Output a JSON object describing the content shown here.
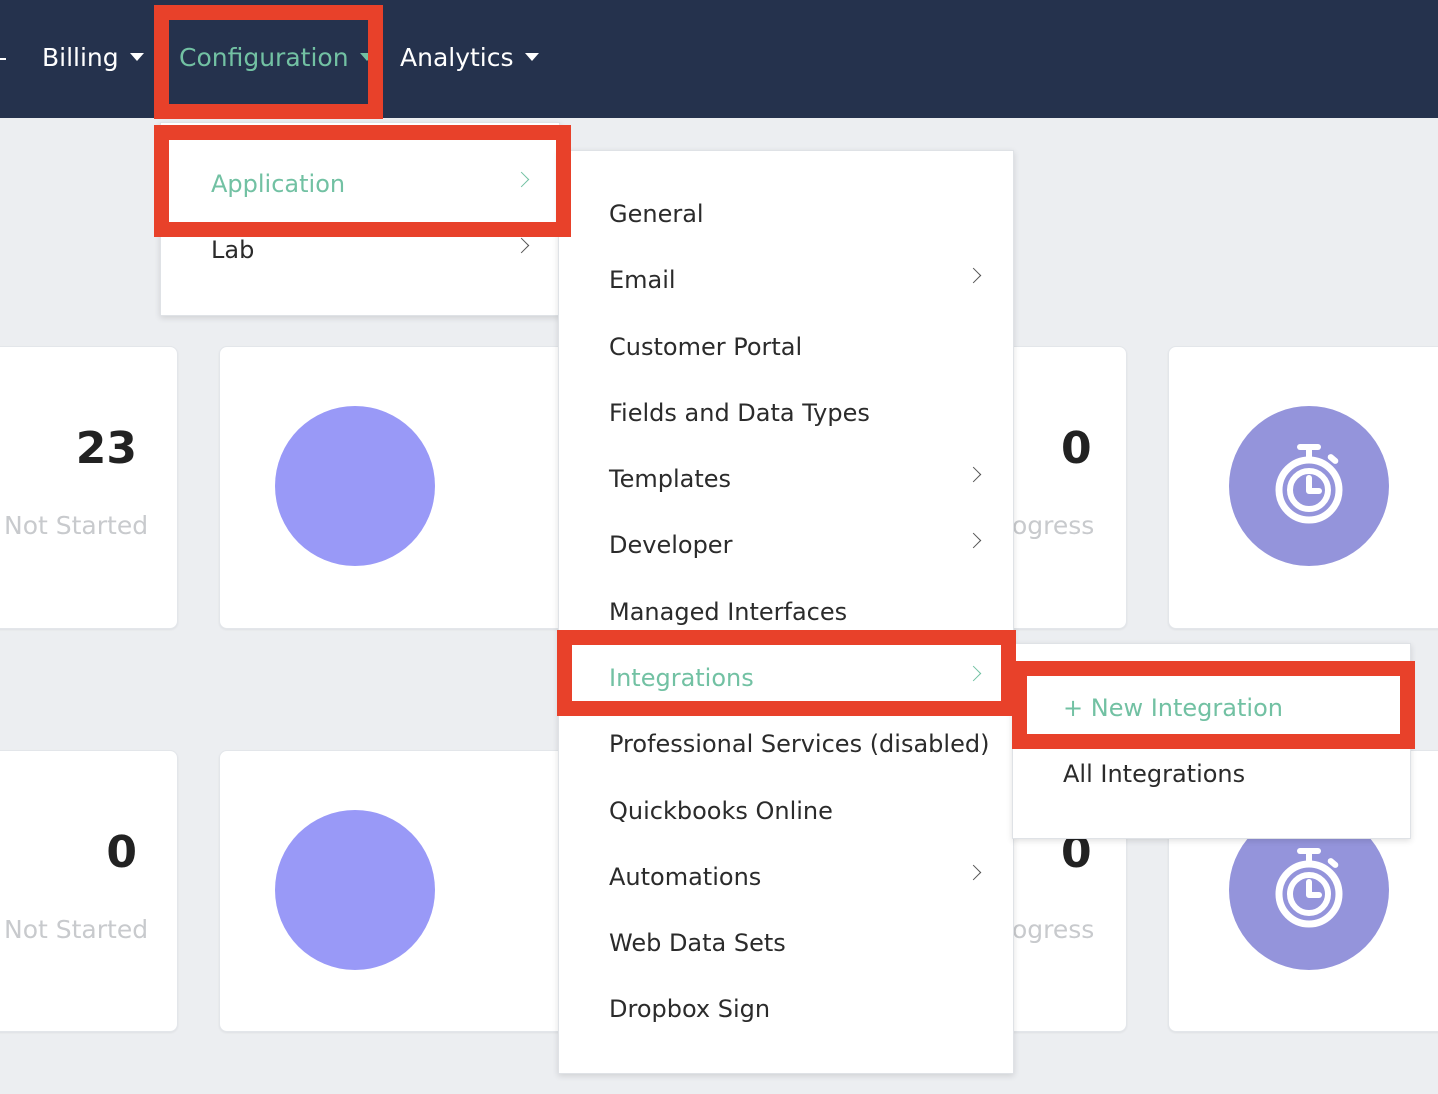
{
  "topnav": {
    "billing": "Billing",
    "configuration": "Configuration",
    "analytics": "Analytics"
  },
  "configuration_menu": {
    "items": [
      "Application",
      "Lab"
    ]
  },
  "application_menu": {
    "items": [
      "General",
      "Email",
      "Customer Portal",
      "Fields and Data Types",
      "Templates",
      "Developer",
      "Managed Interfaces",
      "Integrations",
      "Professional Services (disabled)",
      "Quickbooks Online",
      "Automations",
      "Web Data Sets",
      "Dropbox Sign"
    ]
  },
  "integrations_menu": {
    "items": [
      "+ New Integration",
      "All Integrations"
    ]
  },
  "cards": {
    "row1_left_value": "23",
    "row1_left_label": "Not Started",
    "row1_right_value": "0",
    "row1_right_label": "ogress",
    "row2_left_value": "0",
    "row2_left_label": "Not Started",
    "row2_right_value": "0",
    "row2_right_label": "ogress"
  },
  "colors": {
    "navbar": "#25324d",
    "accent": "#72c1a3",
    "highlight": "#e8412a",
    "circle": "#9999f7",
    "timer_circle": "#9494db"
  },
  "icons": [
    "caret-down-icon",
    "chevron-right-icon",
    "stopwatch-icon"
  ]
}
